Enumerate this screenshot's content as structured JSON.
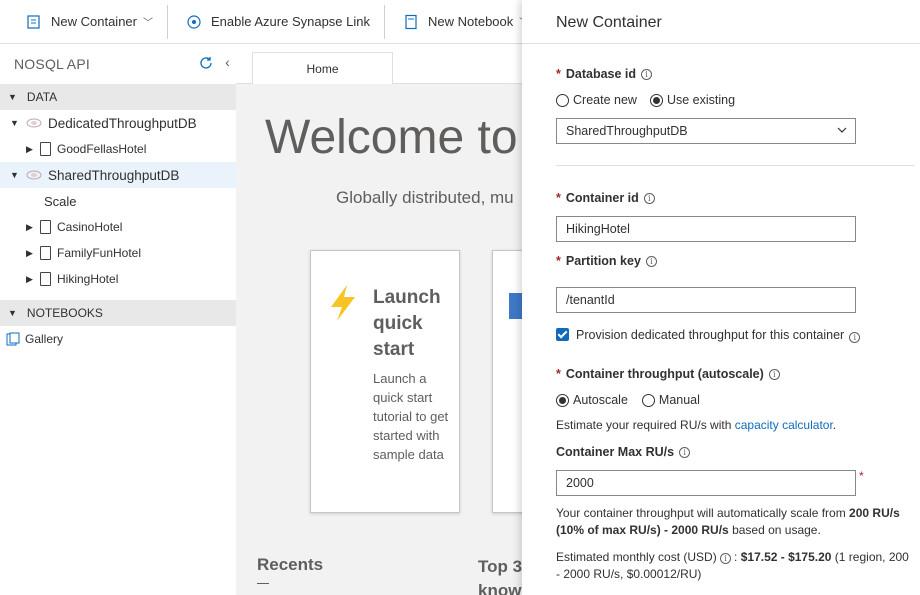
{
  "toolbar": {
    "new_container": "New Container",
    "synapse": "Enable Azure Synapse Link",
    "new_notebook": "New Notebook"
  },
  "sidebar": {
    "title": "NOSQL API",
    "data_section": "DATA",
    "databases": [
      {
        "name": "DedicatedThroughputDB",
        "children": [
          "GoodFellasHotel"
        ]
      },
      {
        "name": "SharedThroughputDB",
        "scale": "Scale",
        "children": [
          "CasinoHotel",
          "FamilyFunHotel",
          "HikingHotel"
        ]
      }
    ],
    "notebooks_section": "NOTEBOOKS",
    "gallery": "Gallery"
  },
  "main": {
    "tab": "Home",
    "welcome": "Welcome to",
    "subtitle": "Globally distributed, mu",
    "card1": {
      "title": "Launch quick start",
      "desc": "Launch a quick start tutorial to get started with sample data"
    },
    "recents": "Recents",
    "top3": "Top 3 know"
  },
  "panel": {
    "title": "New Container",
    "database_id_label": "Database id",
    "radio_create_new": "Create new",
    "radio_use_existing": "Use existing",
    "database_value": "SharedThroughputDB",
    "container_id_label": "Container id",
    "container_id_value": "HikingHotel",
    "partition_key_label": "Partition key",
    "partition_key_value": "/tenantId",
    "provision_label": "Provision dedicated throughput for this container",
    "throughput_label": "Container throughput (autoscale)",
    "radio_autoscale": "Autoscale",
    "radio_manual": "Manual",
    "estimate_text": "Estimate your required RU/s with ",
    "capacity_link": "capacity calculator",
    "estimate_end": ".",
    "max_rus_label": "Container Max RU/s",
    "max_rus_value": "2000",
    "scale_text_1": "Your container throughput will automatically scale from ",
    "scale_bold_1": "200 RU/s (10% of max RU/s) - 2000 RU/s",
    "scale_text_2": " based on usage.",
    "cost_label": "Estimated monthly cost (USD) ",
    "cost_value": "$17.52 - $175.20",
    "cost_detail": " (1 region, 200 - 2000 RU/s, $0.00012/RU)"
  }
}
